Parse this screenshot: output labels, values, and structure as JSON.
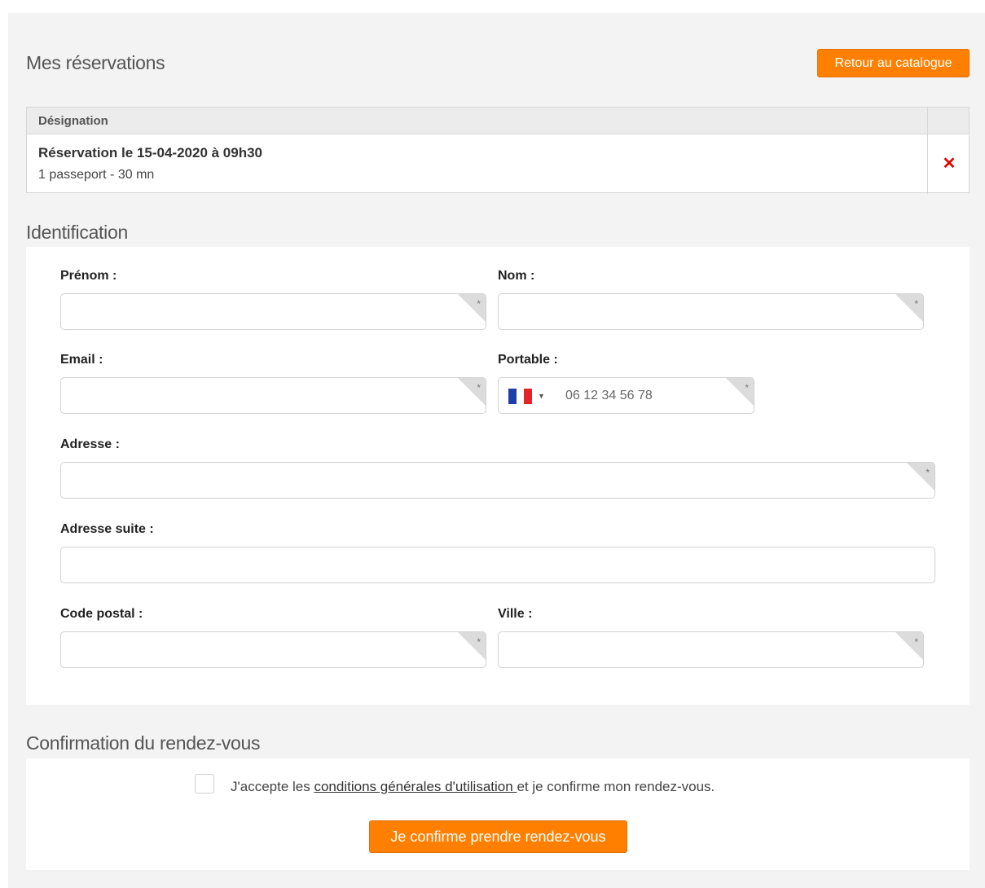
{
  "reservations": {
    "title": "Mes réservations",
    "back_button": "Retour au catalogue",
    "table": {
      "header": "Désignation",
      "rows": [
        {
          "title": "Réservation le 15-04-2020 à 09h30",
          "detail": "1 passeport - 30 mn",
          "remove_icon": "close-icon"
        }
      ]
    }
  },
  "identification": {
    "title": "Identification",
    "required_mark": "*",
    "fields": {
      "prenom": {
        "label": "Prénom :",
        "value": ""
      },
      "nom": {
        "label": "Nom :",
        "value": ""
      },
      "email": {
        "label": "Email :",
        "value": ""
      },
      "portable": {
        "label": "Portable :",
        "placeholder": "06 12 34 56 78",
        "country": "France",
        "flag_colors": [
          "#1f3fa8",
          "#ffffff",
          "#e3242b"
        ]
      },
      "adresse": {
        "label": "Adresse :",
        "value": ""
      },
      "adresse_suite": {
        "label": "Adresse suite :",
        "value": ""
      },
      "code_postal": {
        "label": "Code postal :",
        "value": ""
      },
      "ville": {
        "label": "Ville :",
        "value": ""
      }
    }
  },
  "confirmation": {
    "title": "Confirmation du rendez-vous",
    "checked": false,
    "accept_prefix": "J'accepte les ",
    "accept_link": "conditions générales d'utilisation ",
    "accept_suffix": "et je confirme mon rendez-vous.",
    "confirm_button": "Je confirme prendre rendez-vous"
  },
  "colors": {
    "accent": "#ff8000",
    "delete": "#e00000",
    "background": "#f3f3f3"
  }
}
